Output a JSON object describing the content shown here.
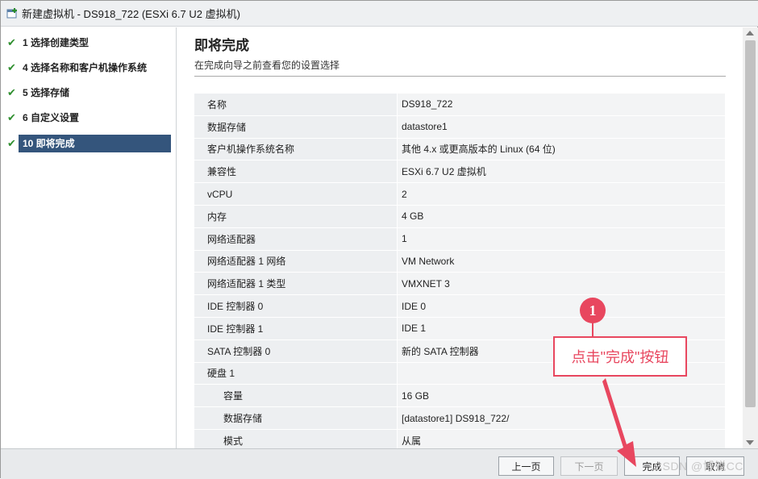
{
  "window": {
    "title": "新建虚拟机 - DS918_722 (ESXi 6.7 U2 虚拟机)",
    "icon": "new-vm-icon"
  },
  "sidebar": {
    "steps": [
      {
        "label": "1 选择创建类型",
        "completed": true,
        "active": false
      },
      {
        "label": "4 选择名称和客户机操作系统",
        "completed": true,
        "active": false
      },
      {
        "label": "5 选择存储",
        "completed": true,
        "active": false
      },
      {
        "label": "6 自定义设置",
        "completed": true,
        "active": false
      },
      {
        "label": "10 即将完成",
        "completed": true,
        "active": true
      }
    ]
  },
  "main": {
    "heading": "即将完成",
    "subheading": "在完成向导之前查看您的设置选择",
    "rows": [
      {
        "key": "名称",
        "value": "DS918_722",
        "indent": false
      },
      {
        "key": "数据存储",
        "value": "datastore1",
        "indent": false
      },
      {
        "key": "客户机操作系统名称",
        "value": "其他 4.x 或更高版本的 Linux (64 位)",
        "indent": false
      },
      {
        "key": "兼容性",
        "value": "ESXi 6.7 U2 虚拟机",
        "indent": false
      },
      {
        "key": "vCPU",
        "value": "2",
        "indent": false
      },
      {
        "key": "内存",
        "value": "4 GB",
        "indent": false
      },
      {
        "key": "网络适配器",
        "value": "1",
        "indent": false
      },
      {
        "key": "网络适配器 1 网络",
        "value": "VM Network",
        "indent": false
      },
      {
        "key": "网络适配器 1 类型",
        "value": "VMXNET 3",
        "indent": false
      },
      {
        "key": "IDE 控制器 0",
        "value": "IDE 0",
        "indent": false
      },
      {
        "key": "IDE 控制器 1",
        "value": "IDE 1",
        "indent": false
      },
      {
        "key": "SATA 控制器 0",
        "value": "新的 SATA 控制器",
        "indent": false
      },
      {
        "key": "硬盘 1",
        "value": "",
        "indent": false
      },
      {
        "key": "容量",
        "value": "16 GB",
        "indent": true
      },
      {
        "key": "数据存储",
        "value": "[datastore1] DS918_722/",
        "indent": true
      },
      {
        "key": "模式",
        "value": "从属",
        "indent": true
      }
    ]
  },
  "footer": {
    "back_label": "上一页",
    "next_label": "下一页",
    "finish_label": "完成",
    "cancel_label": "取消"
  },
  "annotation": {
    "step_number": "1",
    "instruction": "点击\"完成\"按钮",
    "color": "#e8475f"
  },
  "watermark": "CSDN @博锐CC",
  "colors": {
    "active_step_bg": "#34557c",
    "check_color": "#2f8f2f"
  }
}
